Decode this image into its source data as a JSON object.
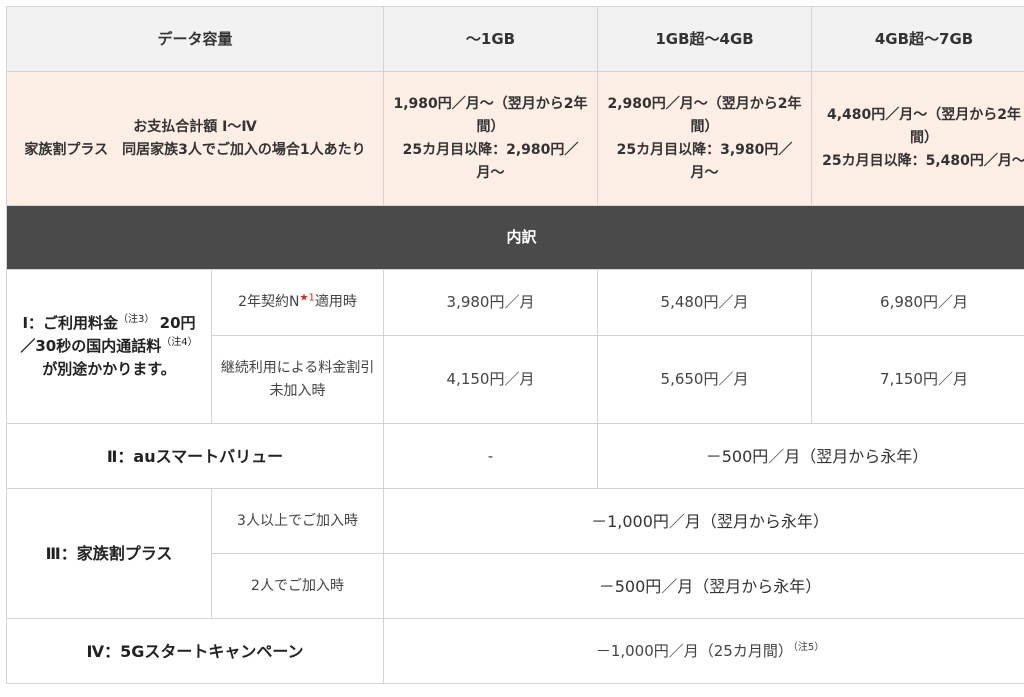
{
  "header": {
    "col_label": "データ容量",
    "plans": [
      "〜1GB",
      "1GB超〜4GB",
      "4GB超〜7GB"
    ]
  },
  "total": {
    "label_lines": [
      "お支払合計額 Ⅰ〜Ⅳ",
      "家族割プラス　同居家族3人でご加入の場合1人あたり"
    ],
    "values": [
      [
        "1,980円／月〜（翌月から2年間）",
        "25カ月目以降：2,980円／月〜"
      ],
      [
        "2,980円／月〜（翌月から2年間）",
        "25カ月目以降：3,980円／月〜"
      ],
      [
        "4,480円／月〜（翌月から2年間）",
        "25カ月目以降：5,480円／月〜"
      ]
    ]
  },
  "section": {
    "label": "内訳"
  },
  "usage": {
    "label": "Ⅰ：ご利用料金",
    "label_note": "（注3）",
    "label_line2": "20円／30秒の国内通話料",
    "label_line2_note": "（注4）",
    "label_line2_tail": "が別途かかります。",
    "sub1": {
      "label": "2年契約N",
      "mark": "★1",
      "tail": "適用時",
      "values": [
        "3,980円／月",
        "5,480円／月",
        "6,980円／月"
      ]
    },
    "sub2": {
      "label": "継続利用による料金割引未加入時",
      "values": [
        "4,150円／月",
        "5,650円／月",
        "7,150円／月"
      ]
    }
  },
  "smart_value": {
    "label": "Ⅱ：auスマートバリュー",
    "value_first": "-",
    "value_rest": "－500円／月（翌月から永年）"
  },
  "family": {
    "label": "Ⅲ：家族割プラス",
    "sub1": {
      "label": "3人以上でご加入時",
      "value": "－1,000円／月（翌月から永年）"
    },
    "sub2": {
      "label": "2人でご加入時",
      "value": "－500円／月（翌月から永年）"
    }
  },
  "campaign": {
    "label": "Ⅳ：5Gスタートキャンペーン",
    "value": "－1,000円／月（25カ月間）",
    "note": "（注5）"
  },
  "colors": {
    "header_bg": "#f2f2f2",
    "total_bg": "#fdeee6",
    "section_bg": "#4a4a4a",
    "mark": "#e02020"
  }
}
